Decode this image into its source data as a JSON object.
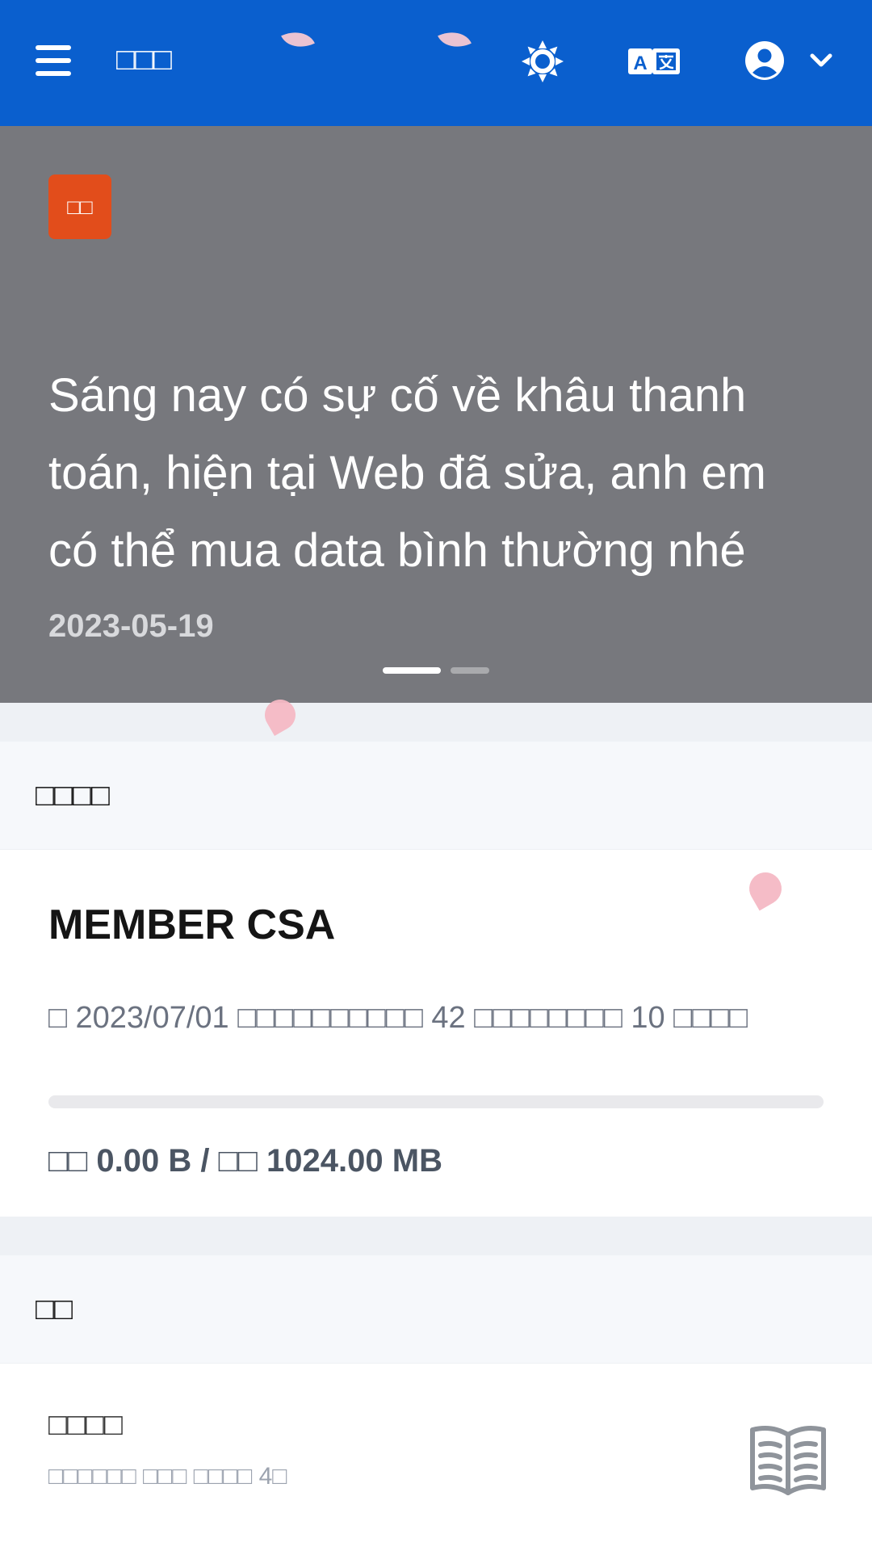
{
  "header": {
    "app_title": "□□□",
    "menu_icon": "menu-icon",
    "theme_icon": "sun-icon",
    "language_icon": "translate-icon",
    "user_icon": "user-circle-icon",
    "dropdown_icon": "chevron-down-icon",
    "background_color": "#0a5fce"
  },
  "banner": {
    "tag": "□□",
    "tag_color": "#e24d1b",
    "text": "Sáng nay có sự cố về khâu thanh toán, hiện tại Web đã sửa, anh em có thể mua data bình thường nhé",
    "date": "2023-05-19",
    "slide_count": 2,
    "active_slide": 1
  },
  "subscription": {
    "section_title": "□□□□",
    "plan_name": "MEMBER CSA",
    "expire_text": "□ 2023/07/01 □□□□□□□□□□ 42 □□□□□□□□ 10 □□□□",
    "usage_fraction": 0,
    "usage_text": "□□ 0.00 B / □□ 1024.00 MB"
  },
  "shortcuts": {
    "section_title": "□□",
    "items": [
      {
        "title": "□□□□",
        "description": "□□□□□□ □□□ □□□□ 4□",
        "icon": "book-open-icon"
      }
    ]
  }
}
